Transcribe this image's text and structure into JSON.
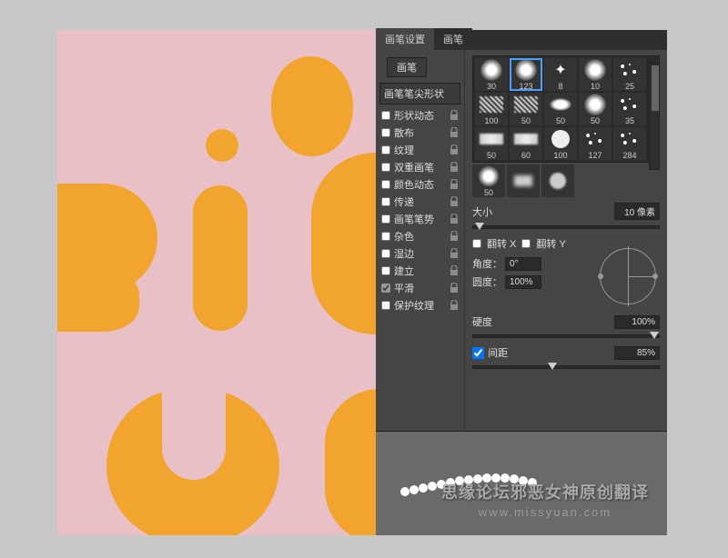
{
  "tabs": {
    "settings": "画笔设置",
    "brushes": "画笔"
  },
  "brush_button": "画笔",
  "tip_shape_header": "画笔笔尖形状",
  "options": [
    {
      "label": "形状动态",
      "checked": false,
      "lock": true
    },
    {
      "label": "散布",
      "checked": false,
      "lock": true
    },
    {
      "label": "纹理",
      "checked": false,
      "lock": true
    },
    {
      "label": "双重画笔",
      "checked": false,
      "lock": true
    },
    {
      "label": "颜色动态",
      "checked": false,
      "lock": true
    },
    {
      "label": "传递",
      "checked": false,
      "lock": true
    },
    {
      "label": "画笔笔势",
      "checked": false,
      "lock": true
    },
    {
      "label": "杂色",
      "checked": false,
      "lock": true
    },
    {
      "label": "湿边",
      "checked": false,
      "lock": true
    },
    {
      "label": "建立",
      "checked": false,
      "lock": true
    },
    {
      "label": "平滑",
      "checked": true,
      "lock": true
    },
    {
      "label": "保护纹理",
      "checked": false,
      "lock": true
    }
  ],
  "brush_presets": [
    {
      "size": "30",
      "type": "soft"
    },
    {
      "size": "123",
      "type": "soft",
      "selected": true
    },
    {
      "size": "8",
      "type": "star"
    },
    {
      "size": "10",
      "type": "soft"
    },
    {
      "size": "25",
      "type": "scatter"
    },
    {
      "size": "100",
      "type": "rough"
    },
    {
      "size": "50",
      "type": "rough"
    },
    {
      "size": "50",
      "type": "oval"
    },
    {
      "size": "50",
      "type": "soft"
    },
    {
      "size": "35",
      "type": "scatter"
    },
    {
      "size": "50",
      "type": "chalk"
    },
    {
      "size": "60",
      "type": "chalk"
    },
    {
      "size": "100",
      "type": "hard"
    },
    {
      "size": "127",
      "type": "scatter"
    },
    {
      "size": "284",
      "type": "scatter"
    }
  ],
  "extra_row_visible": {
    "soft": "50"
  },
  "size": {
    "label": "大小",
    "value": "10 像素"
  },
  "flip": {
    "x": "翻转 X",
    "y": "翻转 Y"
  },
  "angle": {
    "label": "角度：",
    "value": "0°"
  },
  "roundness": {
    "label": "圆度：",
    "value": "100%"
  },
  "hardness": {
    "label": "硬度",
    "value": "100%"
  },
  "spacing": {
    "label": "间距",
    "value": "85%",
    "checked": true
  },
  "watermark": {
    "cn": "思缘论坛邪恶女神原创翻译",
    "en": "www.missyuan.com"
  },
  "colors": {
    "accent_yellow": "#f1a52f",
    "canvas_pink": "#e9c0c6"
  }
}
